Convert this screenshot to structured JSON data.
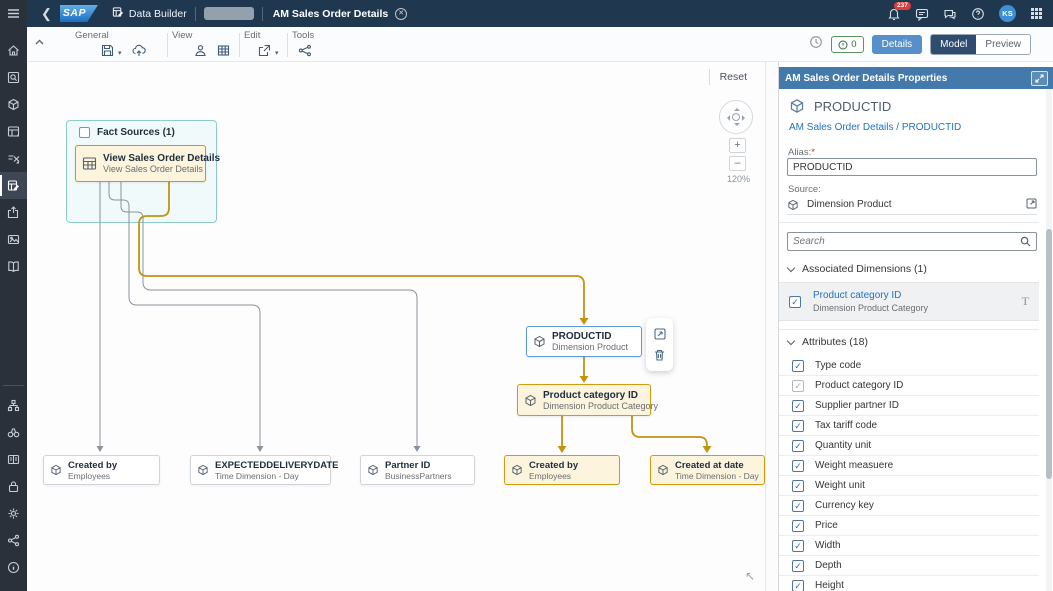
{
  "shell": {
    "brand": "SAP",
    "app_name": "Data Builder",
    "tab_title": "AM Sales Order Details",
    "notifications_count": "237",
    "avatar_initials": "KS"
  },
  "toolbar": {
    "groups": [
      {
        "label": "General"
      },
      {
        "label": "View"
      },
      {
        "label": "Edit"
      },
      {
        "label": "Tools"
      }
    ],
    "messages_count": "0",
    "details_label": "Details",
    "model_label": "Model",
    "preview_label": "Preview"
  },
  "canvas": {
    "reset_label": "Reset",
    "zoom_level": "120%",
    "fact_sources_label": "Fact Sources (1)",
    "nodes": {
      "source": {
        "title": "View Sales Order Details",
        "subtitle": "View Sales Order Details"
      },
      "productid": {
        "title": "PRODUCTID",
        "subtitle": "Dimension Product"
      },
      "product_category": {
        "title": "Product category ID",
        "subtitle": "Dimension Product Category"
      }
    },
    "bottom_nodes": [
      {
        "title": "Created by",
        "subtitle": "Employees",
        "style": "plain"
      },
      {
        "title": "EXPECTEDDELIVERYDATE",
        "subtitle": "Time Dimension - Day",
        "style": "plain"
      },
      {
        "title": "Partner ID",
        "subtitle": "BusinessPartners",
        "style": "plain"
      },
      {
        "title": "Created by",
        "subtitle": "Employees",
        "style": "gold"
      },
      {
        "title": "Created at date",
        "subtitle": "Time Dimension - Day",
        "style": "gold"
      }
    ]
  },
  "properties": {
    "header": "AM Sales Order Details Properties",
    "title": "PRODUCTID",
    "breadcrumb": "AM Sales Order Details / PRODUCTID",
    "alias_label": "Alias:",
    "required_marker": "*",
    "alias_value": "PRODUCTID",
    "source_label": "Source:",
    "source_value": "Dimension Product",
    "search_placeholder": "Search",
    "assoc_section_label": "Associated Dimensions (1)",
    "assoc_items": [
      {
        "title": "Product category ID",
        "subtitle": "Dimension Product Category",
        "checked": true
      }
    ],
    "attr_section_label": "Attributes (18)",
    "attributes": [
      {
        "label": "Type code",
        "checked": true
      },
      {
        "label": "Product category ID",
        "checked": true,
        "disabled": true
      },
      {
        "label": "Supplier partner ID",
        "checked": true
      },
      {
        "label": "Tax tariff code",
        "checked": true
      },
      {
        "label": "Quantity unit",
        "checked": true
      },
      {
        "label": "Weight measuere",
        "checked": true
      },
      {
        "label": "Weight unit",
        "checked": true
      },
      {
        "label": "Currency key",
        "checked": true
      },
      {
        "label": "Price",
        "checked": true
      },
      {
        "label": "Width",
        "checked": true
      },
      {
        "label": "Depth",
        "checked": true
      },
      {
        "label": "Height",
        "checked": true
      }
    ]
  },
  "colors": {
    "shell_bg": "#20384f",
    "accent_blue": "#568fc9",
    "panel_header": "#4379ab",
    "gold_border": "#cf9b13",
    "gold_fill": "#fcf4dd",
    "teal_border": "#8fccc8",
    "link": "#2173c4"
  }
}
